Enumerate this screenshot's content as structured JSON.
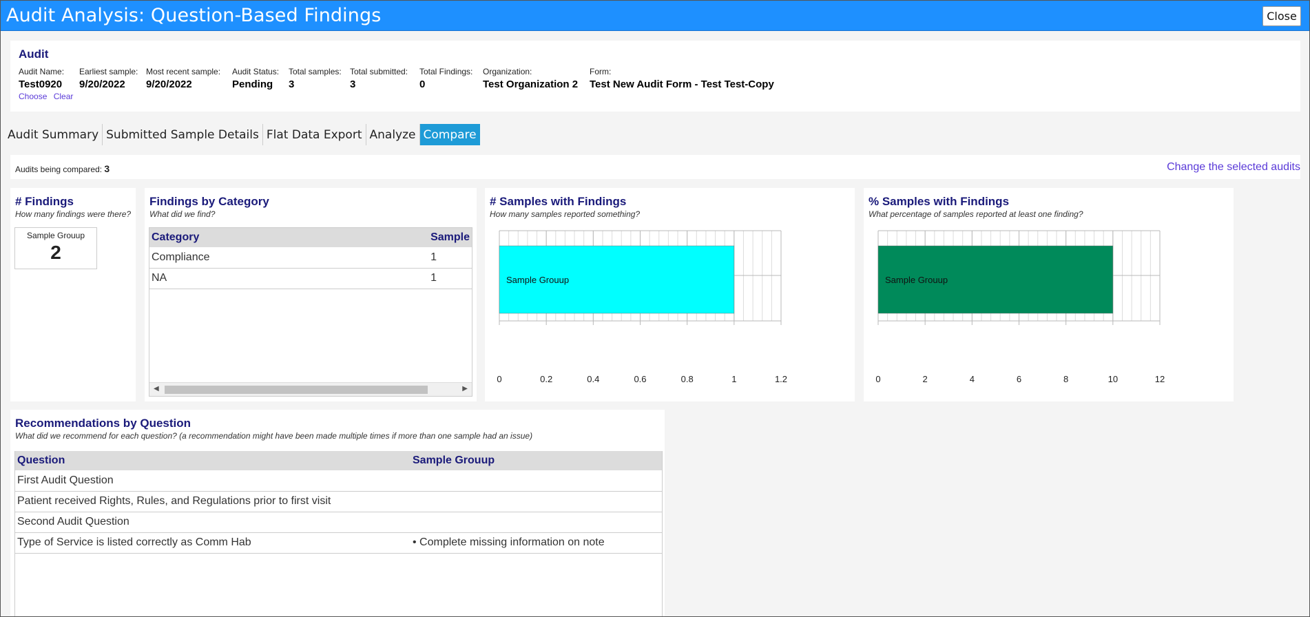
{
  "window": {
    "title": "Audit Analysis: Question-Based Findings",
    "close_label": "Close"
  },
  "audit": {
    "section_title": "Audit",
    "fields": [
      {
        "label": "Audit Name:",
        "value": "Test0920"
      },
      {
        "label": "Earliest sample:",
        "value": "9/20/2022"
      },
      {
        "label": "Most recent sample:",
        "value": "9/20/2022"
      },
      {
        "label": "Audit Status:",
        "value": "Pending"
      },
      {
        "label": "Total samples:",
        "value": "3"
      },
      {
        "label": "Total submitted:",
        "value": "3"
      },
      {
        "label": "Total Findings:",
        "value": "0"
      },
      {
        "label": "Organization:",
        "value": "Test Organization 2"
      },
      {
        "label": "Form:",
        "value": "Test New Audit Form - Test Test-Copy"
      }
    ],
    "links": {
      "choose": "Choose",
      "clear": "Clear"
    }
  },
  "tabs": [
    {
      "label": "Audit Summary",
      "active": false
    },
    {
      "label": "Submitted Sample Details",
      "active": false
    },
    {
      "label": "Flat Data Export",
      "active": false
    },
    {
      "label": "Analyze",
      "active": false
    },
    {
      "label": "Compare",
      "active": true
    }
  ],
  "compare": {
    "label": "Audits being compared:",
    "count": "3",
    "change_link": "Change the selected audits"
  },
  "findings_panel": {
    "title": "# Findings",
    "subtitle": "How many findings were there?",
    "group_name": "Sample Grouup",
    "group_value": "2"
  },
  "category_panel": {
    "title": "Findings by Category",
    "subtitle": "What did we find?",
    "headers": [
      "Category",
      "Sample"
    ],
    "rows": [
      [
        "Compliance",
        "1"
      ],
      [
        "NA",
        "1"
      ]
    ]
  },
  "samples_chart": {
    "title": "# Samples with Findings",
    "subtitle": "How many samples reported something?",
    "bar_color": "#00ffff"
  },
  "pct_chart": {
    "title": "% Samples with Findings",
    "subtitle": "What percentage of samples reported at least one finding?",
    "bar_color": "#008a5a"
  },
  "chart_data": [
    {
      "type": "bar",
      "orientation": "horizontal",
      "categories": [
        "Sample Grouup"
      ],
      "values": [
        1
      ],
      "xlim": [
        0,
        1.2
      ],
      "ticks": [
        "0",
        "0.2",
        "0.4",
        "0.6",
        "0.8",
        "1",
        "1.2"
      ],
      "grid": true
    },
    {
      "type": "bar",
      "orientation": "horizontal",
      "categories": [
        "Sample Grouup"
      ],
      "values": [
        10
      ],
      "xlim": [
        0,
        12
      ],
      "ticks": [
        "0",
        "2",
        "4",
        "6",
        "8",
        "10",
        "12"
      ],
      "grid": true
    }
  ],
  "recommendations": {
    "title": "Recommendations by Question",
    "subtitle": "What did we recommend for each question? (a recommendation might have been made multiple times if more than one sample had an issue)",
    "headers": [
      "Question",
      "Sample Grouup"
    ],
    "rows": [
      [
        "First Audit Question",
        ""
      ],
      [
        "Patient received Rights, Rules, and Regulations prior to first visit",
        ""
      ],
      [
        "Second Audit Question",
        ""
      ],
      [
        "Type of Service is listed correctly as Comm Hab",
        "• Complete missing information on note"
      ]
    ]
  }
}
